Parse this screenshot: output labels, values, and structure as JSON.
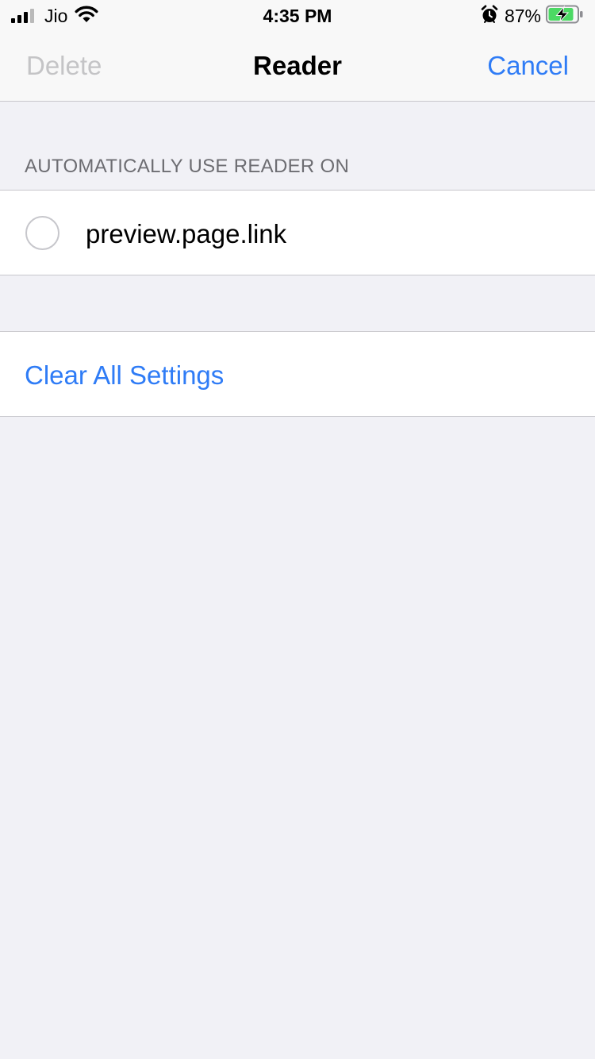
{
  "status_bar": {
    "carrier": "Jio",
    "time": "4:35 PM",
    "battery_percent": "87%",
    "signal_bars_active": 3,
    "signal_bars_total": 4,
    "battery_level": 0.87,
    "icons": [
      "signal-icon",
      "wifi-icon",
      "alarm-icon",
      "battery-charging-icon"
    ]
  },
  "nav": {
    "left_label": "Delete",
    "title": "Reader",
    "right_label": "Cancel"
  },
  "section": {
    "header": "AUTOMATICALLY USE READER ON",
    "items": [
      {
        "label": "preview.page.link",
        "selected": false
      }
    ]
  },
  "actions": {
    "clear_label": "Clear All Settings"
  },
  "colors": {
    "accent": "#2f7cf6",
    "disabled": "#c4c4c6",
    "background": "#f1f1f6",
    "battery_fill": "#4cd964"
  }
}
